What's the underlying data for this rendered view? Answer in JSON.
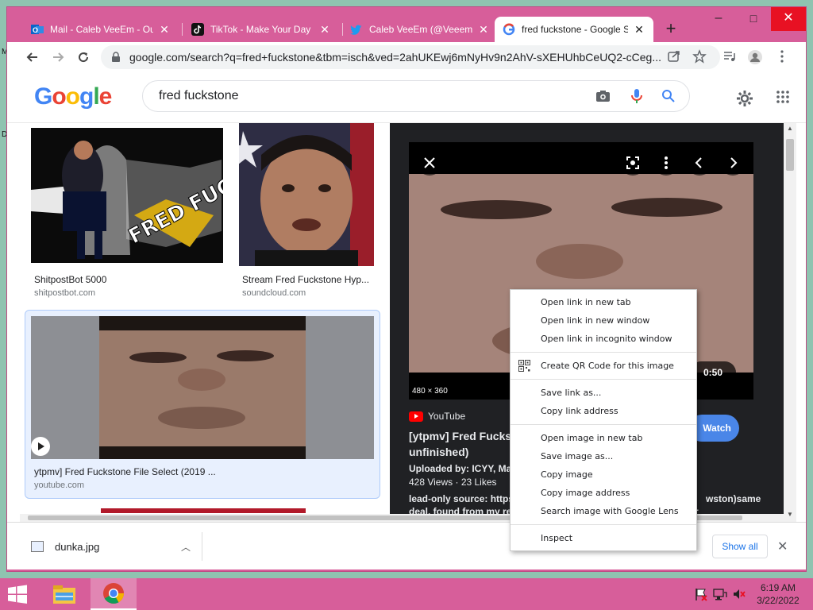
{
  "desktop": {
    "edge_glyph_top": "M",
    "edge_glyph_mid": "D"
  },
  "tabs": [
    {
      "label": "Mail - Caleb VeeEm - Out",
      "icon": "outlook-icon"
    },
    {
      "label": "TikTok - Make Your Day",
      "icon": "tiktok-icon"
    },
    {
      "label": "Caleb VeeEm (@VeeemC",
      "icon": "twitter-icon"
    },
    {
      "label": "fred fuckstone - Google S",
      "icon": "google-icon"
    }
  ],
  "window_controls": {
    "minimize": "–",
    "maximize": "□",
    "close": "✕"
  },
  "toolbar": {
    "url": "google.com/search?q=fred+fuckstone&tbm=isch&ved=2ahUKEwj6mNyHv9n2AhV-sXEHUhbCeUQ2-cCeg..."
  },
  "google": {
    "logo": [
      "G",
      "o",
      "o",
      "g",
      "l",
      "e"
    ],
    "logo_colors": [
      "#4285f4",
      "#ea4335",
      "#fbbc05",
      "#4285f4",
      "#34a853",
      "#ea4335"
    ],
    "query": "fred fuckstone"
  },
  "results": [
    {
      "title": "ShitpostBot 5000",
      "source": "shitpostbot.com",
      "overlay": "FRED FUCKSTONE"
    },
    {
      "title": "Stream Fred Fuckstone Hyp...",
      "source": "soundcloud.com"
    },
    {
      "title": "ytpmv] Fred Fuckstone File Select (2019 ...",
      "source": "youtube.com"
    }
  ],
  "preview": {
    "dimensions": "480 × 360",
    "duration": "0:50",
    "channel": "YouTube",
    "title_line1": "[ytpmv] Fred Fucks",
    "title_line2": "unfinished)",
    "uploaded": "Uploaded by: ICYY, May",
    "views": "428 Views",
    "likes": "23 Likes",
    "desc_line1": "lead-only source: https",
    "desc_line1_right": "wston)same",
    "desc_line2": "deal, found from my re",
    "desc_line2_right": "r",
    "watch_label": "Watch"
  },
  "context_menu": [
    {
      "label": "Open link in new tab"
    },
    {
      "label": "Open link in new window"
    },
    {
      "label": "Open link in incognito window"
    },
    {
      "sep": true
    },
    {
      "label": "Create QR Code for this image",
      "icon": "qr-code-icon"
    },
    {
      "sep": true
    },
    {
      "label": "Save link as..."
    },
    {
      "label": "Copy link address"
    },
    {
      "sep": true
    },
    {
      "label": "Open image in new tab"
    },
    {
      "label": "Save image as..."
    },
    {
      "label": "Copy image"
    },
    {
      "label": "Copy image address"
    },
    {
      "label": "Search image with Google Lens"
    },
    {
      "sep": true
    },
    {
      "label": "Inspect"
    }
  ],
  "downloads": {
    "file": "dunka.jpg",
    "show_all": "Show all"
  },
  "taskbar": {
    "time": "6:19 AM",
    "date": "3/22/2022"
  },
  "colors": {
    "accent": "#d75e9a",
    "google_blue": "#1a73e8"
  }
}
